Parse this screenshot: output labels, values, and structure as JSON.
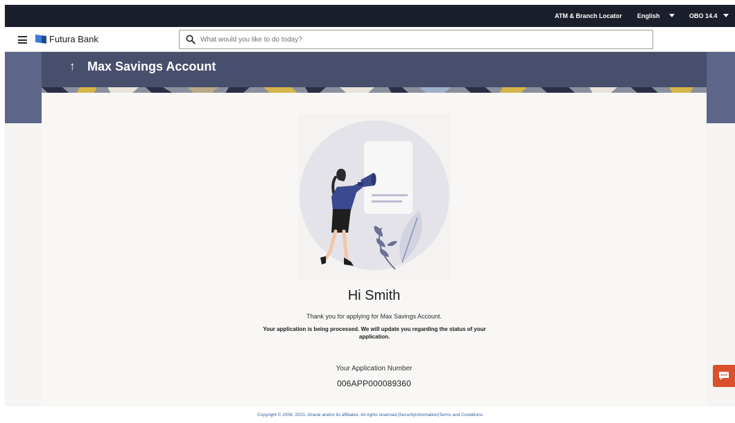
{
  "topbar": {
    "locator": "ATM & Branch Locator",
    "language": "English",
    "version": "OBO 14.4"
  },
  "header": {
    "brand": "Futura Bank",
    "search_placeholder": "What would you like to do today?",
    "search_value": ""
  },
  "banner": {
    "title": "Max Savings Account"
  },
  "confirmation": {
    "greeting": "Hi Smith",
    "thanks": "Thank you for applying for Max Savings Account.",
    "processing": "Your application is being processed. We will update you regarding the status of your application.",
    "app_number_label": "Your Application Number",
    "app_number": "006APP000089360"
  },
  "footer": {
    "copyright": "Copyright © 2006, 2023, Oracle and/or its affiliates. All rights reserved.",
    "security_link": "SecurityInformation",
    "terms_link": "Terms and Conditions"
  },
  "icons": {
    "back": "arrow-up-icon",
    "search": "search-icon",
    "menu": "hamburger-icon",
    "chat": "chat-icon"
  },
  "colors": {
    "topbar": "#1b1f2c",
    "banner": "#474f6c",
    "accent_chat": "#d9512c",
    "illustration_figure": "#3b4a8f"
  }
}
